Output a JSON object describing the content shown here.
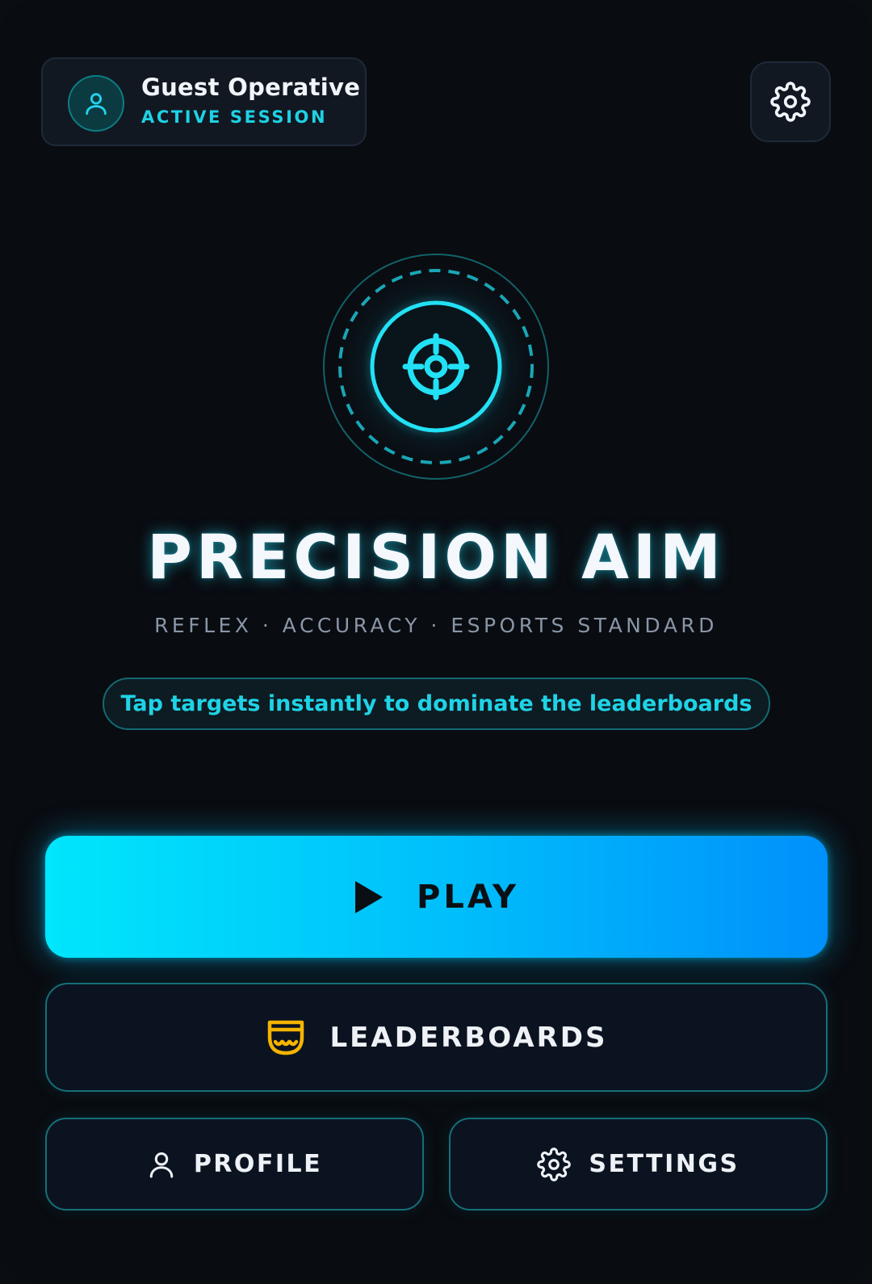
{
  "header": {
    "user_name": "Guest Operative",
    "user_status": "ACTIVE SESSION"
  },
  "hero": {
    "title": "PRECISION AIM",
    "tagline": "REFLEX · ACCURACY · ESPORTS STANDARD",
    "hint": "Tap targets instantly to dominate the leaderboards"
  },
  "menu": {
    "play_label": "PLAY",
    "leaderboards_label": "LEADERBOARDS",
    "profile_label": "PROFILE",
    "settings_label": "SETTINGS"
  },
  "icons": {
    "avatar": "user-icon",
    "top_settings": "gear-icon",
    "emblem": "crosshair-icon",
    "play": "play-icon",
    "leaderboards": "trophy-icon",
    "profile": "user-icon",
    "settings": "gear-icon"
  },
  "colors": {
    "background": "#090c11",
    "accent_cyan": "#22d3ee",
    "play_gradient_start": "#00e6fb",
    "play_gradient_end": "#0090fb",
    "trophy_gold": "#f5b400",
    "outline": "#156f78"
  }
}
